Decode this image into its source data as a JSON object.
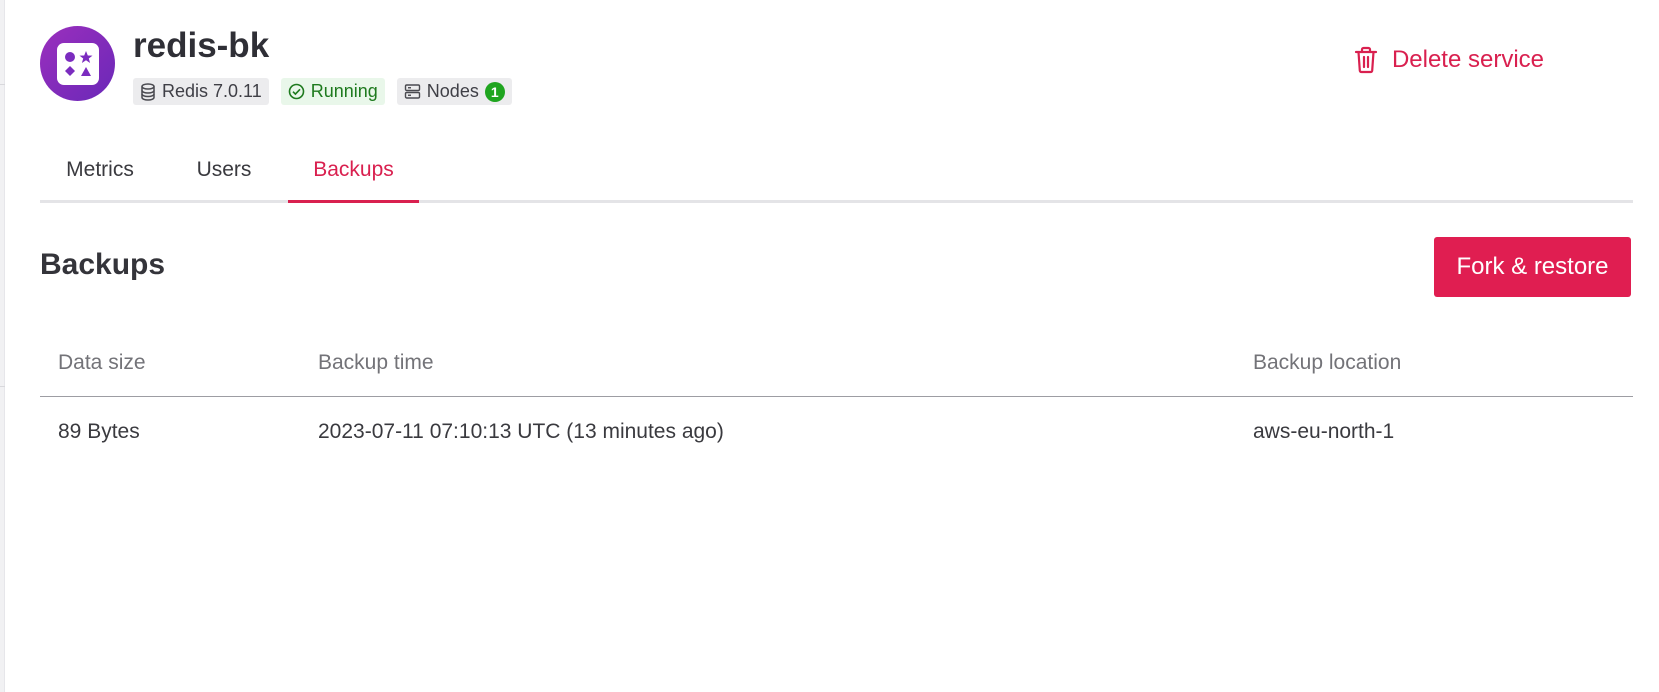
{
  "service": {
    "name": "redis-bk",
    "logo_icon": "shapes-icon",
    "badges": {
      "version": "Redis 7.0.11",
      "status": "Running",
      "nodes_label": "Nodes",
      "nodes_count": "1"
    },
    "delete_label": "Delete service"
  },
  "tabs": [
    {
      "label": "Metrics",
      "active": false
    },
    {
      "label": "Users",
      "active": false
    },
    {
      "label": "Backups",
      "active": true
    }
  ],
  "section": {
    "title": "Backups",
    "fork_label": "Fork & restore"
  },
  "table": {
    "headers": [
      "Data size",
      "Backup time",
      "Backup location"
    ],
    "rows": [
      [
        "89 Bytes",
        "2023-07-11 07:10:13 UTC (13 minutes ago)",
        "aws-eu-north-1"
      ]
    ]
  },
  "colors": {
    "accent": "#e01e51",
    "logo": "#7b2cbf",
    "running": "#1e7a1e"
  }
}
